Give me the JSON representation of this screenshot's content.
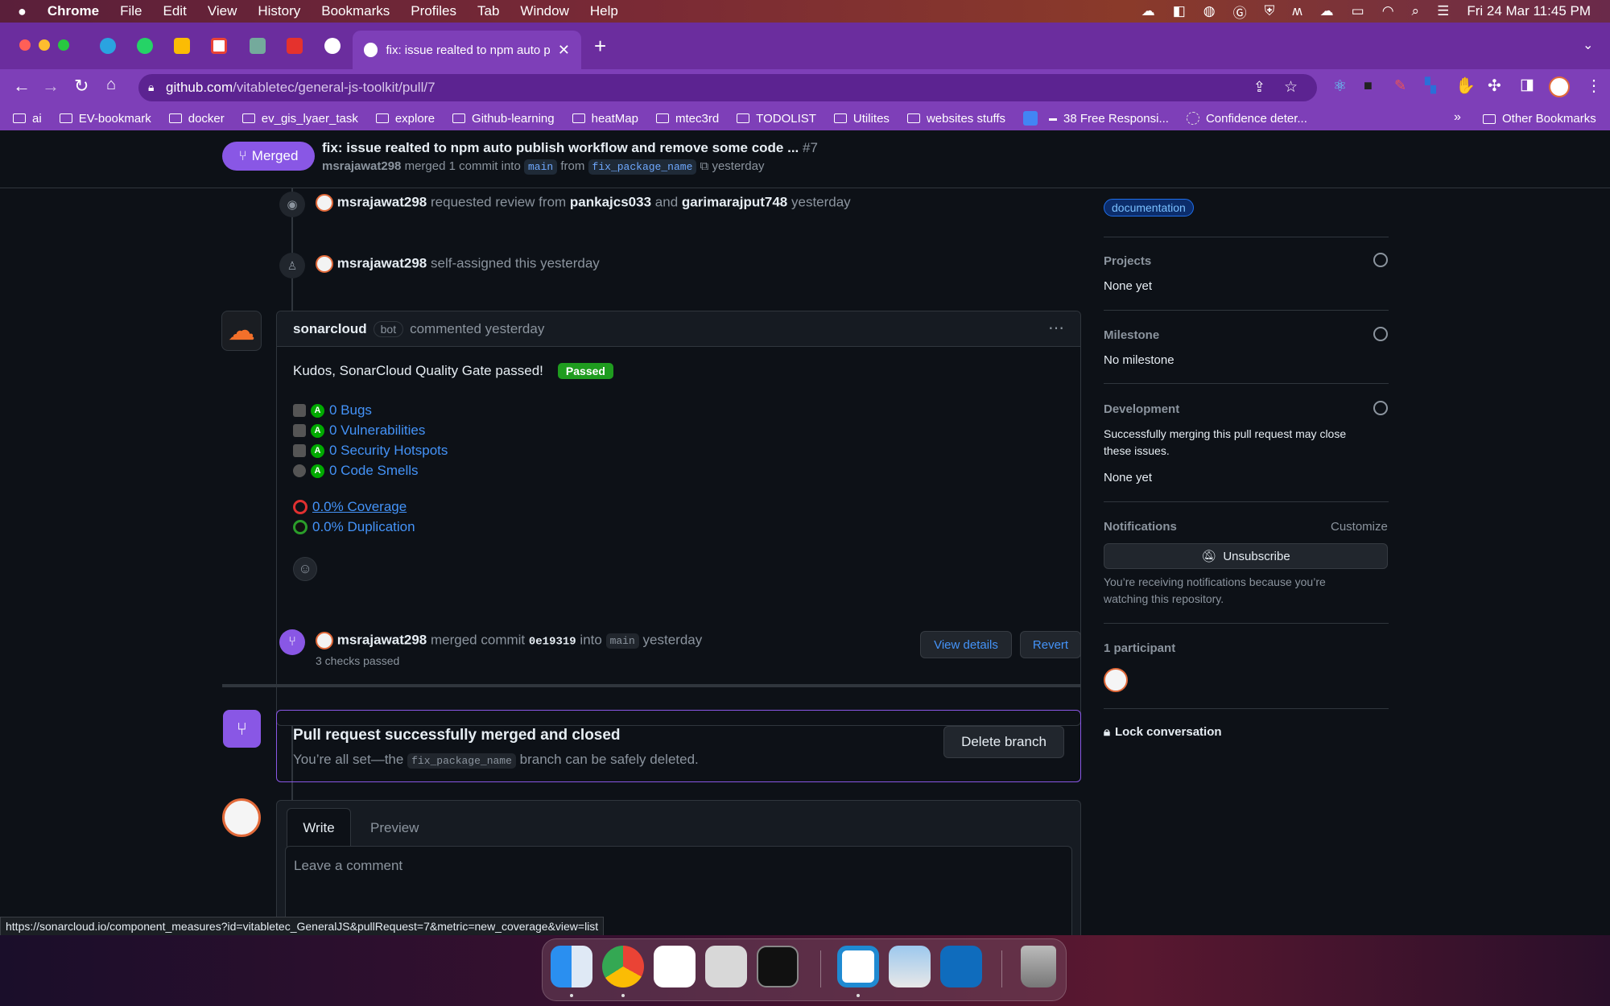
{
  "menubar": {
    "app": "Chrome",
    "items": [
      "File",
      "Edit",
      "View",
      "History",
      "Bookmarks",
      "Profiles",
      "Tab",
      "Window",
      "Help"
    ],
    "clock": "Fri 24 Mar  11:45 PM"
  },
  "browser": {
    "active_tab_title": "fix: issue realted to npm auto p",
    "url_host": "github.com",
    "url_path": "/vitabletec/general-js-toolkit/pull/7",
    "bookmarks": [
      "ai",
      "EV-bookmark",
      "docker",
      "ev_gis_lyaer_task",
      "explore",
      "Github-learning",
      "heatMap",
      "mtec3rd",
      "TODOLIST",
      "Utilites",
      "websites stuffs",
      "38 Free Responsi...",
      "Confidence deter..."
    ],
    "bookmarks_overflow": "»",
    "other_bookmarks": "Other Bookmarks"
  },
  "pr_header": {
    "state": "Merged",
    "title": "fix: issue realted to npm auto publish workflow and remove some code ...",
    "number": "#7",
    "author": "msrajawat298",
    "merged_text": "merged 1 commit into",
    "base": "main",
    "from": "from",
    "head": "fix_package_name",
    "time": "yesterday"
  },
  "timeline": {
    "review_request": {
      "user": "msrajawat298",
      "text": "requested review from",
      "rev1": "pankajcs033",
      "and": "and",
      "rev2": "garimarajput748",
      "time": "yesterday"
    },
    "self_assigned": {
      "user": "msrajawat298",
      "text": "self-assigned this yesterday"
    },
    "comment": {
      "author": "sonarcloud",
      "badge": "bot",
      "action": "commented yesterday",
      "kudos": "Kudos, SonarCloud Quality Gate passed!",
      "passed": "Passed",
      "grade": "A",
      "metrics": [
        "0 Bugs",
        "0 Vulnerabilities",
        "0 Security Hotspots",
        "0 Code Smells"
      ],
      "coverage": "0.0% Coverage",
      "duplication": "0.0% Duplication"
    },
    "merge_event": {
      "user": "msrajawat298",
      "text": "merged commit",
      "sha": "0e19319",
      "into": "into",
      "base": "main",
      "time": "yesterday",
      "checks": "3 checks passed",
      "view_details": "View details",
      "revert": "Revert"
    }
  },
  "merged_box": {
    "title": "Pull request successfully merged and closed",
    "pre": "You’re all set—the",
    "branch": "fix_package_name",
    "post": "branch can be safely deleted.",
    "delete_btn": "Delete branch"
  },
  "comment_form": {
    "write": "Write",
    "preview": "Preview",
    "placeholder": "Leave a comment"
  },
  "sidebar": {
    "label": "documentation",
    "projects": {
      "title": "Projects",
      "value": "None yet"
    },
    "milestone": {
      "title": "Milestone",
      "value": "No milestone"
    },
    "development": {
      "title": "Development",
      "desc1": "Successfully merging this pull request may close",
      "desc2": "these issues.",
      "value": "None yet"
    },
    "notifications": {
      "title": "Notifications",
      "customize": "Customize",
      "button": "Unsubscribe",
      "note1": "You’re receiving notifications because you’re",
      "note2": "watching this repository."
    },
    "participants": "1 participant",
    "lock": "Lock conversation"
  },
  "status_url": "https://sonarcloud.io/component_measures?id=vitabletec_GeneralJS&pullRequest=7&metric=new_coverage&view=list",
  "colors": {
    "merged": "#8957e5",
    "link": "#4493f8",
    "passed": "#1f9c1f",
    "bg": "#0d1117"
  }
}
